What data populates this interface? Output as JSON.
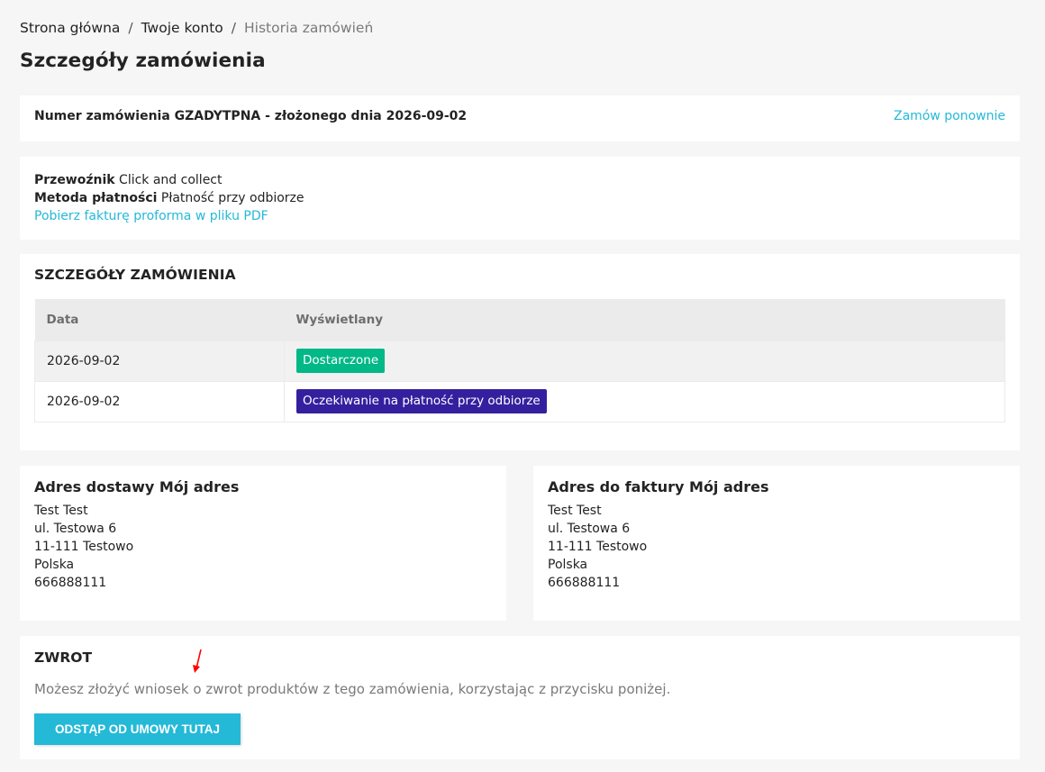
{
  "breadcrumb": {
    "home": "Strona główna",
    "account": "Twoje konto",
    "current": "Historia zamówień",
    "separator": "/"
  },
  "page_title": "Szczegóły zamówienia",
  "order": {
    "reference_text": "Numer zamówienia GZADYTPNA - złożonego dnia 2026-09-02",
    "reorder_label": "Zamów ponownie"
  },
  "info": {
    "carrier_label": "Przewoźnik",
    "carrier_value": "Click and collect",
    "payment_label": "Metoda płatności",
    "payment_value": "Płatność przy odbiorze",
    "invoice_link": "Pobierz fakturę proforma w pliku PDF"
  },
  "history": {
    "title": "SZCZEGÓŁY ZAMÓWIENIA",
    "columns": [
      "Data",
      "Wyświetlany"
    ],
    "rows": [
      {
        "date": "2026-09-02",
        "status": "Dostarczone",
        "color": "#01b887"
      },
      {
        "date": "2026-09-02",
        "status": "Oczekiwanie na płatność przy odbiorze",
        "color": "#34209e"
      }
    ]
  },
  "delivery_address": {
    "title": "Adres dostawy Mój adres",
    "lines": [
      "Test Test",
      "ul. Testowa 6",
      "11-111 Testowo",
      "Polska",
      "666888111"
    ]
  },
  "invoice_address": {
    "title": "Adres do faktury Mój adres",
    "lines": [
      "Test Test",
      "ul. Testowa 6",
      "11-111 Testowo",
      "Polska",
      "666888111"
    ]
  },
  "returns": {
    "title": "ZWROT",
    "description": "Możesz złożyć wniosek o zwrot produktów z tego zamówienia, korzystając z przycisku poniżej.",
    "button_label": "ODSTĄP OD UMOWY TUTAJ"
  },
  "colors": {
    "accent": "#24b9d7",
    "delivered": "#01b887",
    "awaiting_payment": "#34209e",
    "annotation_arrow": "#ff0000"
  }
}
